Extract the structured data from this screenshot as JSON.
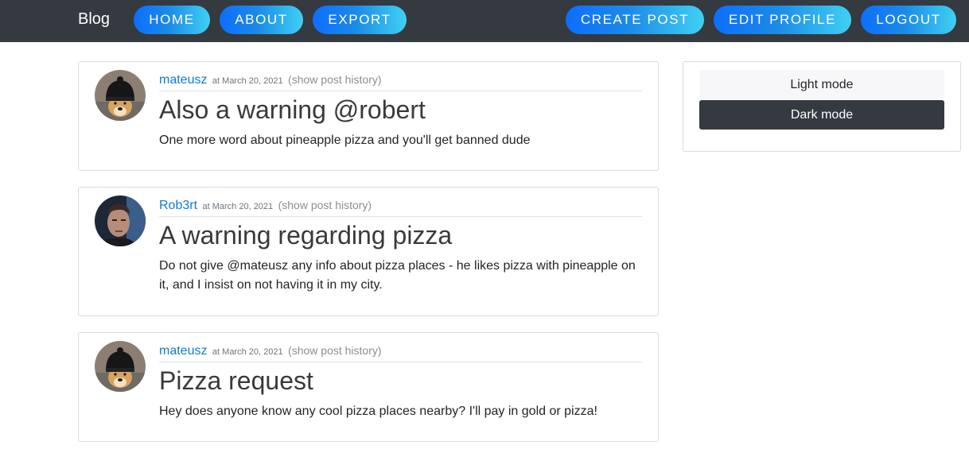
{
  "navbar": {
    "brand": "Blog",
    "left_items": [
      "HOME",
      "ABOUT",
      "EXPORT"
    ],
    "right_items": [
      "CREATE POST",
      "EDIT PROFILE",
      "LOGOUT"
    ]
  },
  "posts": [
    {
      "author": "mateusz",
      "date": "at March 20, 2021",
      "history": "(show post history)",
      "title": "Also a warning @robert",
      "body": "One more word about pineapple pizza and you'll get banned dude",
      "avatar_icon": "doge-beanie-avatar"
    },
    {
      "author": "Rob3rt",
      "date": "at March 20, 2021",
      "history": "(show post history)",
      "title": "A warning regarding pizza",
      "body": "Do not give @mateusz any info about pizza places - he likes pizza with pineapple on it, and I insist on not having it in my city.",
      "avatar_icon": "man-portrait-avatar"
    },
    {
      "author": "mateusz",
      "date": "at March 20, 2021",
      "history": "(show post history)",
      "title": "Pizza request",
      "body": "Hey does anyone know any cool pizza places nearby? I'll pay in gold or pizza!",
      "avatar_icon": "doge-beanie-avatar"
    }
  ],
  "sidebar": {
    "light_mode": "Light mode",
    "dark_mode": "Dark mode",
    "selected": "Dark mode"
  },
  "colors": {
    "navbar_bg": "#343a40",
    "button_gradient_start": "#0d6efd",
    "button_gradient_end": "#3fd0f4",
    "author_link": "#0d7bd3"
  }
}
